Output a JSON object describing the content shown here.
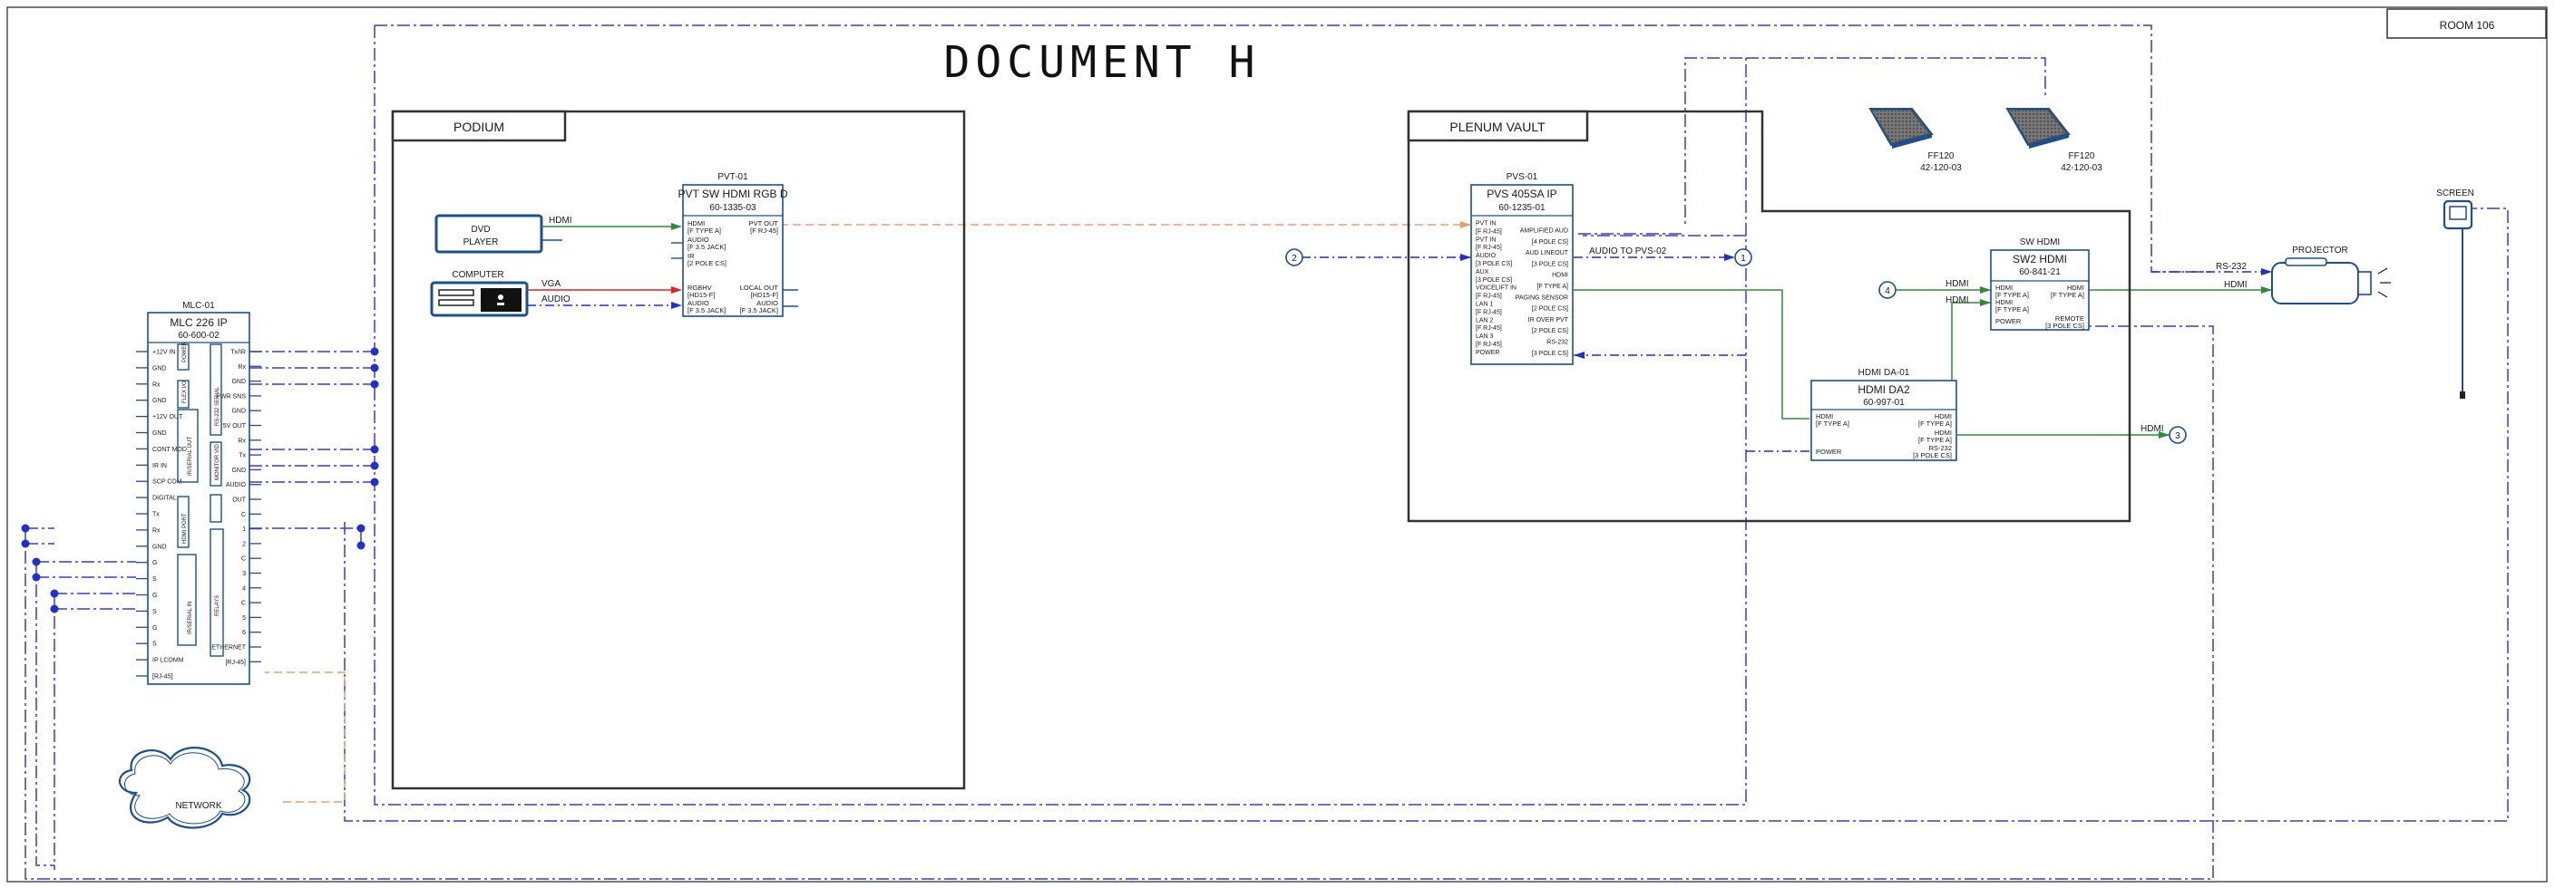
{
  "document": {
    "title": "DOCUMENT H",
    "room": "ROOM 106"
  },
  "zones": {
    "podium": "PODIUM",
    "plenum": "PLENUM VAULT"
  },
  "sources": {
    "dvd": [
      "DVD",
      "PLAYER"
    ],
    "computer": "COMPUTER",
    "network": "NETWORK"
  },
  "signals": {
    "hdmi": "HDMI",
    "vga": "VGA",
    "audio": "AUDIO",
    "rs232": "RS-232",
    "audio_to_pvs": "AUDIO TO PVS-02"
  },
  "mlc": {
    "tag": "MLC-01",
    "model": "MLC 226 IP",
    "part": "60-600-02",
    "left_pins": [
      "+12V IN",
      "GND",
      "Rx",
      "GND",
      "+12V OUT",
      "GND",
      "CONT MOD",
      "IR IN",
      "SCP COM",
      "DIGITAL",
      "Tx",
      "Rx",
      "GND",
      "G",
      "S",
      "G",
      "S",
      "G",
      "S",
      "IP LCOMM",
      "[RJ-45]"
    ],
    "right_pins": [
      "Tx/IR",
      "Rx",
      "GND",
      "PWR SNS",
      "GND",
      "5V OUT",
      "Rx",
      "Tx",
      "GND",
      "AUDIO",
      "OUT",
      "C",
      "1",
      "2",
      "C",
      "3",
      "4",
      "C",
      "5",
      "6",
      "ETHERNET",
      "[RJ-45]"
    ],
    "side_labels": [
      "POWER",
      "FLEX I/O",
      "IR/SERIAL OUT",
      "RS-232 SERIAL",
      "HDMI PORT",
      "MONITOR VID",
      "IR/SERIAL IN",
      "RELAYS"
    ]
  },
  "pvt": {
    "tag": "PVT-01",
    "model": "PVT SW HDMI RGB D",
    "part": "60-1335-03",
    "inputs": [
      "HDMI",
      "[F TYPE A]",
      "AUDIO",
      "[F 3.5 JACK]",
      "IR",
      "[2 POLE CS]",
      "RGBHV",
      "[HD15-F]",
      "AUDIO",
      "[F 3.5 JACK]"
    ],
    "outputs": [
      "PVT OUT",
      "[F RJ-45]",
      "LOCAL OUT",
      "[HD15-F]",
      "AUDIO",
      "[F 3.5 JACK]"
    ]
  },
  "pvs": {
    "tag": "PVS-01",
    "model": "PVS 405SA IP",
    "part": "60-1235-01",
    "left_pins": [
      "PVT IN",
      "[F RJ-45]",
      "PVT IN",
      "[F RJ-45]",
      "AUDIO",
      "[3 POLE CS]",
      "AUX",
      "[3 POLE CS]",
      "VOICELIFT IN",
      "[F RJ-45]",
      "LAN 1",
      "[F RJ-45]",
      "LAN 2",
      "[F RJ-45]",
      "LAN 3",
      "[F RJ-45]",
      "POWER"
    ],
    "right_pins": [
      "AMPLIFIED AUD",
      "[4 POLE CS]",
      "AUD LINEOUT",
      "[3 POLE CS]",
      "HDMI",
      "[F TYPE A]",
      "PAGING SENSOR",
      "[2 POLE CS]",
      "IR OVER PVT",
      "[2 POLE CS]",
      "RS-232",
      "[3 POLE CS]"
    ]
  },
  "da": {
    "tag": "HDMI DA-01",
    "model": "HDMI DA2",
    "part": "60-997-01",
    "in_pins": [
      "HDMI",
      "[F TYPE A]",
      "POWER"
    ],
    "out_pins": [
      "HDMI",
      "[F TYPE A]",
      "HDMI",
      "[F TYPE A]",
      "RS-232",
      "[3 POLE CS]"
    ]
  },
  "sw": {
    "tag": "SW HDMI",
    "model": "SW2 HDMI",
    "part": "60-841-21",
    "in_pins": [
      "HDMI",
      "[F TYPE A]",
      "HDMI",
      "[F TYPE A]",
      "POWER"
    ],
    "out_pins": [
      "HDMI",
      "[F TYPE A]",
      "REMOTE",
      "[3 POLE CS]"
    ]
  },
  "speakers": [
    {
      "model": "FF120",
      "part": "42-120-03"
    },
    {
      "model": "FF120",
      "part": "42-120-03"
    }
  ],
  "projector": "PROJECTOR",
  "screen": "SCREEN",
  "markers": [
    "1",
    "2",
    "3",
    "4"
  ]
}
